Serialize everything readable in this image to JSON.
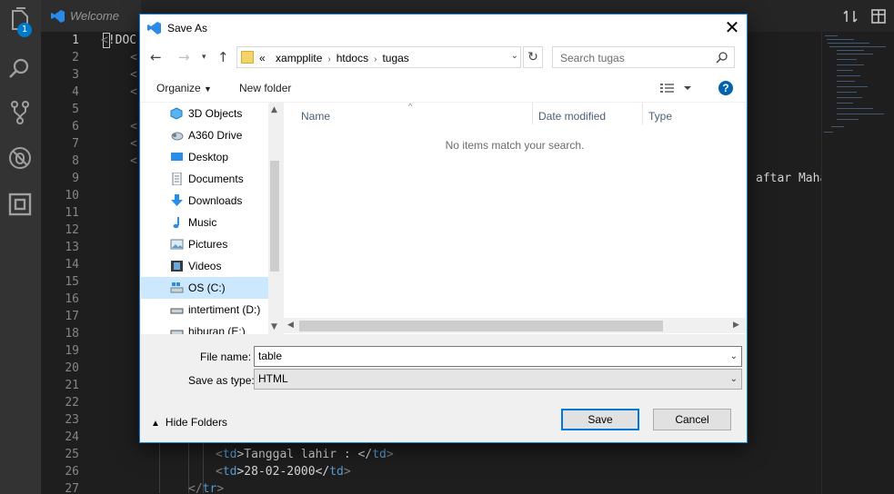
{
  "activity_bar": {
    "explorer_badge": "1",
    "icons": [
      "explorer-icon",
      "search-icon",
      "source-control-icon",
      "debug-icon",
      "extensions-icon"
    ]
  },
  "tabs": [
    {
      "label": "Welcome"
    }
  ],
  "editor": {
    "line_numbers": [
      "1",
      "2",
      "3",
      "4",
      "5",
      "6",
      "7",
      "8",
      "9",
      "10",
      "11",
      "12",
      "13",
      "14",
      "15",
      "16",
      "17",
      "18",
      "19",
      "20",
      "21",
      "22",
      "23",
      "24",
      "25",
      "26",
      "27"
    ],
    "visible_code": {
      "line1": "!DOC",
      "line9_tail": "aftar Mahas",
      "line25_open": "<",
      "line25_tag": "td",
      "line25_text": ">Tanggal lahir : </",
      "line25_tag2": "td",
      "line25_close": ">",
      "line26_open": "<",
      "line26_tag": "td",
      "line26_text": ">28-02-2000</",
      "line26_tag2": "td",
      "line26_close": ">",
      "line27_open": "</",
      "line27_tag": "tr",
      "line27_close": ">"
    }
  },
  "dialog": {
    "title": "Save As",
    "address": {
      "prefix": "«",
      "crumbs": [
        "xampplite",
        "htdocs",
        "tugas"
      ]
    },
    "search_placeholder": "Search tugas",
    "toolbar": {
      "organize": "Organize",
      "new_folder": "New folder"
    },
    "nav_items": [
      {
        "label": "3D Objects",
        "icon": "3d-objects-icon"
      },
      {
        "label": "A360 Drive",
        "icon": "cloud-drive-icon"
      },
      {
        "label": "Desktop",
        "icon": "desktop-icon"
      },
      {
        "label": "Documents",
        "icon": "documents-icon"
      },
      {
        "label": "Downloads",
        "icon": "downloads-icon"
      },
      {
        "label": "Music",
        "icon": "music-icon"
      },
      {
        "label": "Pictures",
        "icon": "pictures-icon"
      },
      {
        "label": "Videos",
        "icon": "videos-icon"
      },
      {
        "label": "OS (C:)",
        "icon": "drive-c-icon",
        "selected": true
      },
      {
        "label": "intertiment (D:)",
        "icon": "drive-icon"
      },
      {
        "label": "hiburan (E:)",
        "icon": "drive-icon"
      }
    ],
    "columns": {
      "name": "Name",
      "date": "Date modified",
      "type": "Type"
    },
    "empty_message": "No items match your search.",
    "file_name_label": "File name:",
    "file_name_value": "table",
    "save_type_label": "Save as type:",
    "save_type_value": "HTML",
    "hide_folders": "Hide Folders",
    "save_button": "Save",
    "cancel_button": "Cancel"
  },
  "colors": {
    "accent": "#007acc",
    "dialog_border": "#1883d7",
    "selection": "#cce8ff"
  }
}
